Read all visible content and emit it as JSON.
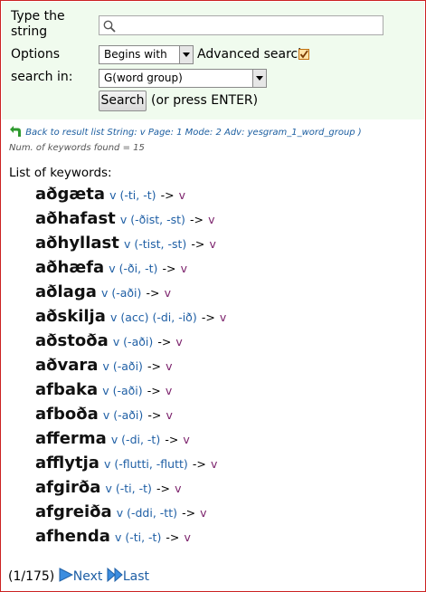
{
  "search": {
    "string_label_1": "Type the",
    "string_label_2": "string",
    "string_value": "",
    "options_label": "Options",
    "mode_value": "Begins with",
    "advanced_label": "Advanced search",
    "advanced_checked": true,
    "searchin_label": "search in:",
    "searchin_value": "G(word group)",
    "search_button": "Search",
    "enter_hint": "(or press ENTER)"
  },
  "result": {
    "back_link": "Back to result list String: v Page: 1 Mode: 2 Adv: yesgram_1_word_group )",
    "count_text": "Num. of keywords found = 15",
    "list_title": "List of keywords:",
    "arrow": "->",
    "entries": [
      {
        "word": "aðgæta",
        "gram": "v (-ti, -t)",
        "target": "v"
      },
      {
        "word": "aðhafast",
        "gram": "v (-ðist, -st)",
        "target": "v"
      },
      {
        "word": "aðhyllast",
        "gram": "v (-tist, -st)",
        "target": "v"
      },
      {
        "word": "aðhæfa",
        "gram": "v (-ði, -t)",
        "target": "v"
      },
      {
        "word": "aðlaga",
        "gram": "v (-aði)",
        "target": "v"
      },
      {
        "word": "aðskilja",
        "gram": "v (acc) (-di, -ið)",
        "target": "v"
      },
      {
        "word": "aðstoða",
        "gram": "v (-aði)",
        "target": "v"
      },
      {
        "word": "aðvara",
        "gram": "v (-aði)",
        "target": "v"
      },
      {
        "word": "afbaka",
        "gram": "v (-aði)",
        "target": "v"
      },
      {
        "word": "afboða",
        "gram": "v (-aði)",
        "target": "v"
      },
      {
        "word": "afferma",
        "gram": "v (-di, -t)",
        "target": "v"
      },
      {
        "word": "afflytja",
        "gram": "v (-flutti, -flutt)",
        "target": "v"
      },
      {
        "word": "afgirða",
        "gram": "v (-ti, -t)",
        "target": "v"
      },
      {
        "word": "afgreiða",
        "gram": "v (-ddi, -tt)",
        "target": "v"
      },
      {
        "word": "afhenda",
        "gram": "v (-ti, -t)",
        "target": "v"
      }
    ]
  },
  "pager": {
    "position": "(1/175)",
    "next": "Next",
    "last": "Last"
  }
}
